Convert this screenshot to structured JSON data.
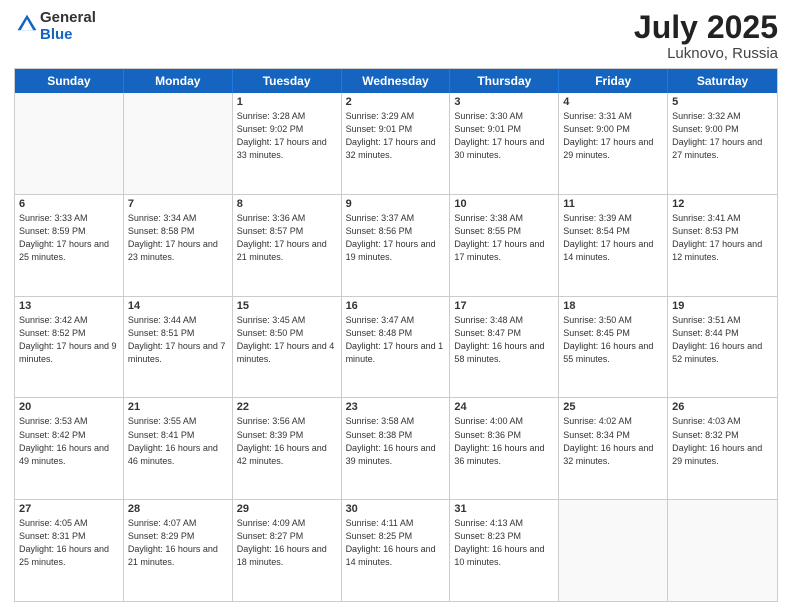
{
  "header": {
    "logo_general": "General",
    "logo_blue": "Blue",
    "title": "July 2025",
    "location": "Luknovo, Russia"
  },
  "days_of_week": [
    "Sunday",
    "Monday",
    "Tuesday",
    "Wednesday",
    "Thursday",
    "Friday",
    "Saturday"
  ],
  "weeks": [
    [
      {
        "day": "",
        "info": ""
      },
      {
        "day": "",
        "info": ""
      },
      {
        "day": "1",
        "info": "Sunrise: 3:28 AM\nSunset: 9:02 PM\nDaylight: 17 hours and 33 minutes."
      },
      {
        "day": "2",
        "info": "Sunrise: 3:29 AM\nSunset: 9:01 PM\nDaylight: 17 hours and 32 minutes."
      },
      {
        "day": "3",
        "info": "Sunrise: 3:30 AM\nSunset: 9:01 PM\nDaylight: 17 hours and 30 minutes."
      },
      {
        "day": "4",
        "info": "Sunrise: 3:31 AM\nSunset: 9:00 PM\nDaylight: 17 hours and 29 minutes."
      },
      {
        "day": "5",
        "info": "Sunrise: 3:32 AM\nSunset: 9:00 PM\nDaylight: 17 hours and 27 minutes."
      }
    ],
    [
      {
        "day": "6",
        "info": "Sunrise: 3:33 AM\nSunset: 8:59 PM\nDaylight: 17 hours and 25 minutes."
      },
      {
        "day": "7",
        "info": "Sunrise: 3:34 AM\nSunset: 8:58 PM\nDaylight: 17 hours and 23 minutes."
      },
      {
        "day": "8",
        "info": "Sunrise: 3:36 AM\nSunset: 8:57 PM\nDaylight: 17 hours and 21 minutes."
      },
      {
        "day": "9",
        "info": "Sunrise: 3:37 AM\nSunset: 8:56 PM\nDaylight: 17 hours and 19 minutes."
      },
      {
        "day": "10",
        "info": "Sunrise: 3:38 AM\nSunset: 8:55 PM\nDaylight: 17 hours and 17 minutes."
      },
      {
        "day": "11",
        "info": "Sunrise: 3:39 AM\nSunset: 8:54 PM\nDaylight: 17 hours and 14 minutes."
      },
      {
        "day": "12",
        "info": "Sunrise: 3:41 AM\nSunset: 8:53 PM\nDaylight: 17 hours and 12 minutes."
      }
    ],
    [
      {
        "day": "13",
        "info": "Sunrise: 3:42 AM\nSunset: 8:52 PM\nDaylight: 17 hours and 9 minutes."
      },
      {
        "day": "14",
        "info": "Sunrise: 3:44 AM\nSunset: 8:51 PM\nDaylight: 17 hours and 7 minutes."
      },
      {
        "day": "15",
        "info": "Sunrise: 3:45 AM\nSunset: 8:50 PM\nDaylight: 17 hours and 4 minutes."
      },
      {
        "day": "16",
        "info": "Sunrise: 3:47 AM\nSunset: 8:48 PM\nDaylight: 17 hours and 1 minute."
      },
      {
        "day": "17",
        "info": "Sunrise: 3:48 AM\nSunset: 8:47 PM\nDaylight: 16 hours and 58 minutes."
      },
      {
        "day": "18",
        "info": "Sunrise: 3:50 AM\nSunset: 8:45 PM\nDaylight: 16 hours and 55 minutes."
      },
      {
        "day": "19",
        "info": "Sunrise: 3:51 AM\nSunset: 8:44 PM\nDaylight: 16 hours and 52 minutes."
      }
    ],
    [
      {
        "day": "20",
        "info": "Sunrise: 3:53 AM\nSunset: 8:42 PM\nDaylight: 16 hours and 49 minutes."
      },
      {
        "day": "21",
        "info": "Sunrise: 3:55 AM\nSunset: 8:41 PM\nDaylight: 16 hours and 46 minutes."
      },
      {
        "day": "22",
        "info": "Sunrise: 3:56 AM\nSunset: 8:39 PM\nDaylight: 16 hours and 42 minutes."
      },
      {
        "day": "23",
        "info": "Sunrise: 3:58 AM\nSunset: 8:38 PM\nDaylight: 16 hours and 39 minutes."
      },
      {
        "day": "24",
        "info": "Sunrise: 4:00 AM\nSunset: 8:36 PM\nDaylight: 16 hours and 36 minutes."
      },
      {
        "day": "25",
        "info": "Sunrise: 4:02 AM\nSunset: 8:34 PM\nDaylight: 16 hours and 32 minutes."
      },
      {
        "day": "26",
        "info": "Sunrise: 4:03 AM\nSunset: 8:32 PM\nDaylight: 16 hours and 29 minutes."
      }
    ],
    [
      {
        "day": "27",
        "info": "Sunrise: 4:05 AM\nSunset: 8:31 PM\nDaylight: 16 hours and 25 minutes."
      },
      {
        "day": "28",
        "info": "Sunrise: 4:07 AM\nSunset: 8:29 PM\nDaylight: 16 hours and 21 minutes."
      },
      {
        "day": "29",
        "info": "Sunrise: 4:09 AM\nSunset: 8:27 PM\nDaylight: 16 hours and 18 minutes."
      },
      {
        "day": "30",
        "info": "Sunrise: 4:11 AM\nSunset: 8:25 PM\nDaylight: 16 hours and 14 minutes."
      },
      {
        "day": "31",
        "info": "Sunrise: 4:13 AM\nSunset: 8:23 PM\nDaylight: 16 hours and 10 minutes."
      },
      {
        "day": "",
        "info": ""
      },
      {
        "day": "",
        "info": ""
      }
    ]
  ]
}
